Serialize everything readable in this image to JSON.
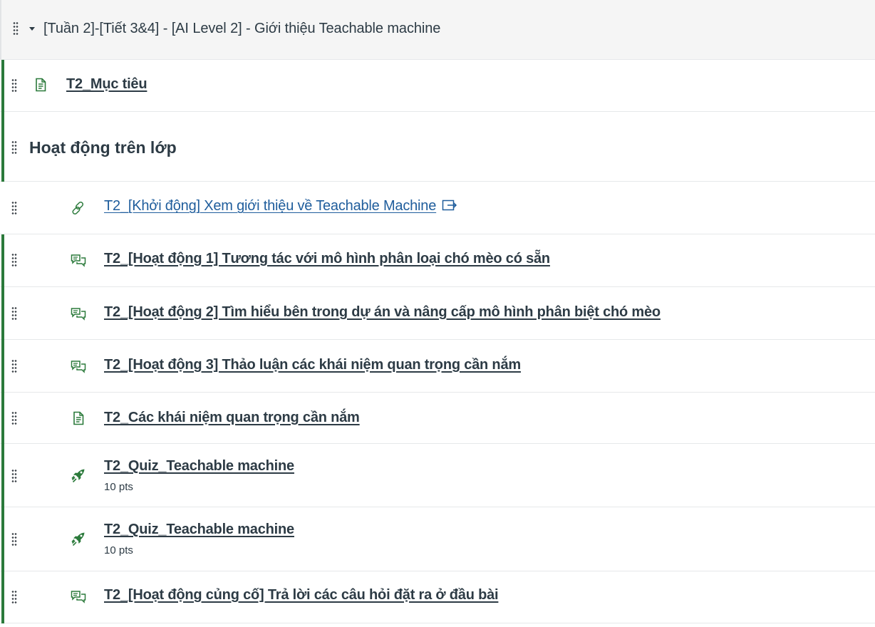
{
  "module": {
    "title": "[Tuần 2]-[Tiết 3&4] - [AI Level 2] - Giới thiệu Teachable machine",
    "drag_icon": "drag-handle-icon",
    "collapse_icon": "caret-down-icon"
  },
  "items": [
    {
      "type": "page",
      "icon": "document-icon",
      "title": "T2_Mục tiêu"
    },
    {
      "type": "subheader",
      "title": "Hoạt động trên lớp"
    },
    {
      "type": "external-link",
      "icon": "link-icon",
      "title": "T2_[Khởi động] Xem giới thiệu về Teachable Machine",
      "ext_icon": "external-link-icon"
    },
    {
      "type": "discussion",
      "icon": "discussion-icon",
      "title": "T2_[Hoạt động 1] Tương tác với mô hình phân loại chó mèo có sẵn"
    },
    {
      "type": "discussion",
      "icon": "discussion-icon",
      "title": "T2_[Hoạt động 2] Tìm hiểu bên trong dự án và nâng cấp mô hình phân biệt chó mèo"
    },
    {
      "type": "discussion",
      "icon": "discussion-icon",
      "title": "T2_[Hoạt động 3] Thảo luận các khái niệm quan trọng cần nắm"
    },
    {
      "type": "page",
      "icon": "document-icon",
      "title": "T2_Các khái niệm quan trọng cần nắm"
    },
    {
      "type": "quiz",
      "icon": "quiz-rocket-icon",
      "title": "T2_Quiz_Teachable machine",
      "points": "10 pts"
    },
    {
      "type": "quiz",
      "icon": "quiz-rocket-icon",
      "title": "T2_Quiz_Teachable machine",
      "points": "10 pts"
    },
    {
      "type": "discussion",
      "icon": "discussion-icon",
      "title": "T2_[Hoạt động củng cố] Trả lời các câu hỏi đặt ra ở đầu bài"
    }
  ],
  "colors": {
    "published": "#2b7a3b",
    "link": "#1f5d9c",
    "text": "#2d3b45",
    "header_bg": "#f5f5f5"
  }
}
